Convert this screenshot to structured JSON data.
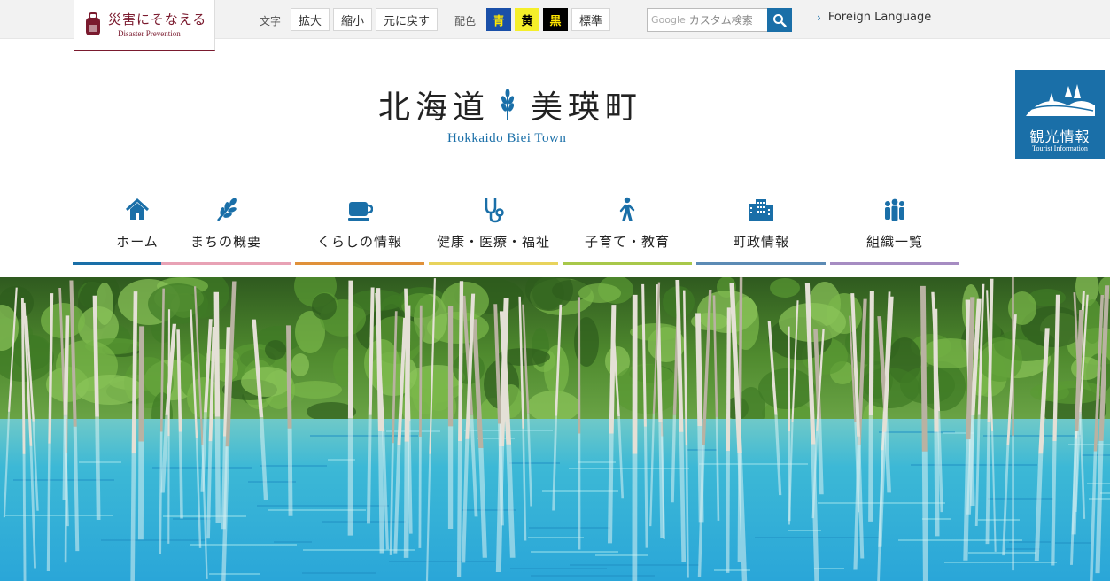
{
  "disaster": {
    "jp": "災害にそなえる",
    "en": "Disaster Prevention"
  },
  "font_size": {
    "label": "文字",
    "enlarge": "拡大",
    "shrink": "縮小",
    "reset": "元に戻す"
  },
  "color_scheme": {
    "label": "配色",
    "blue": "青",
    "yellow": "黄",
    "black": "黒",
    "standard": "標準"
  },
  "search": {
    "google_label": "Google",
    "placeholder": "カスタム検索"
  },
  "foreign_language": "Foreign Language",
  "logo": {
    "title_left": "北海道",
    "title_right": "美瑛町",
    "subtitle": "Hokkaido Biei Town"
  },
  "tourist": {
    "jp": "観光情報",
    "en": "Tourist Information"
  },
  "nav": [
    {
      "label": "ホーム",
      "icon": "home-icon",
      "color": "#1a6fa8"
    },
    {
      "label": "まちの概要",
      "icon": "wheat-icon",
      "color": "#e8a2b5"
    },
    {
      "label": "くらしの情報",
      "icon": "cup-icon",
      "color": "#e0913a"
    },
    {
      "label": "健康・医療・福祉",
      "icon": "stethoscope-icon",
      "color": "#e8d35c"
    },
    {
      "label": "子育て・教育",
      "icon": "walking-child-icon",
      "color": "#a8c84a"
    },
    {
      "label": "町政情報",
      "icon": "building-icon",
      "color": "#5c8bb5"
    },
    {
      "label": "組織一覧",
      "icon": "people-icon",
      "color": "#a68cc2"
    }
  ],
  "colors": {
    "brand_blue": "#1a6fa8",
    "disaster_red": "#7a1a2e",
    "scheme_blue": "#1a4fa8",
    "scheme_yellow": "#f5ef2a",
    "scheme_black": "#000000"
  },
  "hero": {
    "subject": "blue-pond-photo"
  }
}
